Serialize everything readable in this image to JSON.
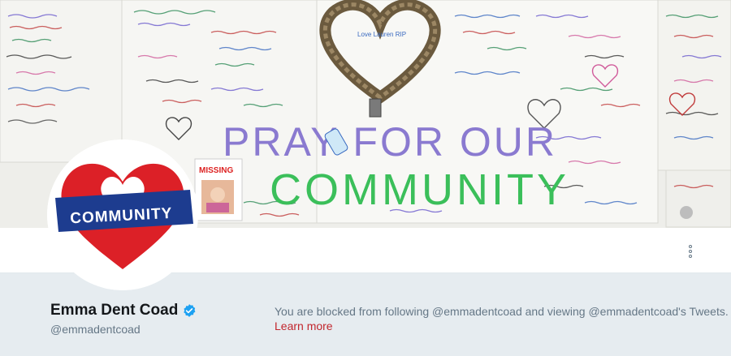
{
  "banner": {
    "headline_line1": "PRAY FOR OUR",
    "headline_line2": "COMMUNITY",
    "missing_poster_label": "MISSING",
    "wreath_tag_text": "Love Lauren RIP"
  },
  "avatar": {
    "banner_text": "COMMUNITY",
    "heart_color": "#dc2027",
    "ribbon_color": "#1d3c8f"
  },
  "profile": {
    "display_name": "Emma Dent Coad",
    "handle": "@emmadentcoad",
    "verified": true
  },
  "notice": {
    "message": "You are blocked from following @emmadentcoad and viewing @emmadentcoad's Tweets.",
    "link_label": "Learn more"
  },
  "colors": {
    "link": "#c2262d",
    "verified": "#1da1f2",
    "background": "#e6ecf0"
  }
}
